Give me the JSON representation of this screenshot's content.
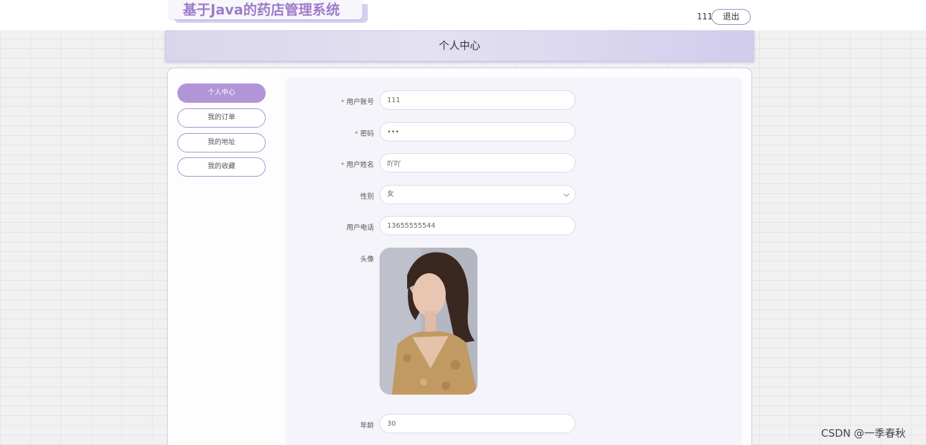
{
  "header": {
    "app_title": "基于Java的药店管理系统",
    "username": "111",
    "logout_label": "退出"
  },
  "page": {
    "title": "个人中心"
  },
  "sidebar": {
    "items": [
      {
        "label": "个人中心",
        "active": true
      },
      {
        "label": "我的订单",
        "active": false
      },
      {
        "label": "我的地址",
        "active": false
      },
      {
        "label": "我的收藏",
        "active": false
      }
    ]
  },
  "form": {
    "required_mark": "*",
    "account": {
      "label": "用户账号",
      "value": "111"
    },
    "password": {
      "label": "密码",
      "value": "•••"
    },
    "name": {
      "label": "用户姓名",
      "value": "吖吖"
    },
    "gender": {
      "label": "性别",
      "value": "女"
    },
    "phone": {
      "label": "用户电话",
      "value": "13655555544"
    },
    "avatar": {
      "label": "头像"
    },
    "age": {
      "label": "年龄",
      "value": "30"
    }
  },
  "watermark": "CSDN @一季春秋",
  "colors": {
    "accent": "#b195d6",
    "title": "#9d7cc9",
    "required": "#e05757"
  }
}
